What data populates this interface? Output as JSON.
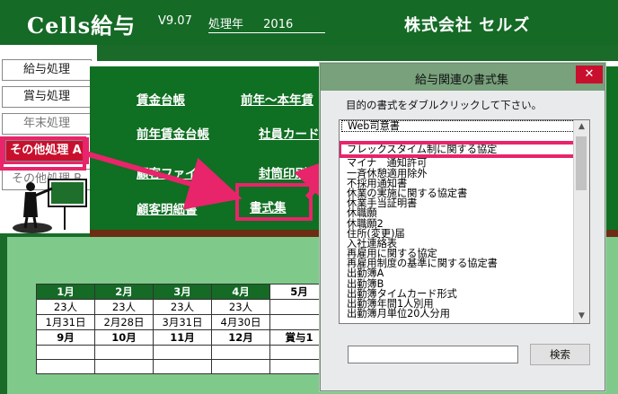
{
  "header": {
    "app_title": "Cells給与",
    "version": "V9.07",
    "year_label": "処理年",
    "year_value": "2016",
    "company": "株式会社 セルズ"
  },
  "sidebar": {
    "items": [
      {
        "label": "給与処理"
      },
      {
        "label": "賞与処理"
      },
      {
        "label": "年末処理"
      },
      {
        "label": "その他処理 A"
      },
      {
        "label": "その他処理 B"
      }
    ]
  },
  "main_menu": {
    "links": [
      {
        "label": "賃金台帳"
      },
      {
        "label": "前年～本年賃"
      },
      {
        "label": "前年賃金台帳"
      },
      {
        "label": "社員カード"
      },
      {
        "label": "顧客ファイル"
      },
      {
        "label": "封筒印刷"
      },
      {
        "label": "顧客明細書"
      },
      {
        "label": "書式集"
      }
    ]
  },
  "calendar": {
    "row1": [
      "1月",
      "2月",
      "3月",
      "4月",
      "5月"
    ],
    "row2": [
      "23人",
      "23人",
      "23人",
      "23人",
      ""
    ],
    "row3": [
      "1月31日",
      "2月28日",
      "3月31日",
      "4月30日",
      ""
    ],
    "row4": [
      "9月",
      "10月",
      "11月",
      "12月",
      "賞与1"
    ]
  },
  "dialog": {
    "title": "給与関連の書式集",
    "close_glyph": "✕",
    "instruction": "目的の書式をダブルクリックして下さい。",
    "items": [
      "Web司意書",
      "フレックスタイム制に関する協定",
      "マイナ　通知許可",
      "一斉休憩適用除外",
      "不採用通知書",
      "休業の実施に関する協定書",
      "休業手当証明書",
      "休職願",
      "休職願2",
      "住所(変更)届",
      "入社連絡表",
      "再雇用に関する協定",
      "再雇用制度の基準に関する協定書",
      "出勤簿A",
      "出勤簿B",
      "出勤簿タイムカード形式",
      "出勤簿年間1人別用",
      "出勤簿月単位20人分用"
    ],
    "search_button": "検索",
    "search_value": ""
  },
  "colors": {
    "header_green": "#156a26",
    "main_green": "#0f6f22",
    "highlight_pink": "#e8246b",
    "active_red": "#c8102e"
  }
}
